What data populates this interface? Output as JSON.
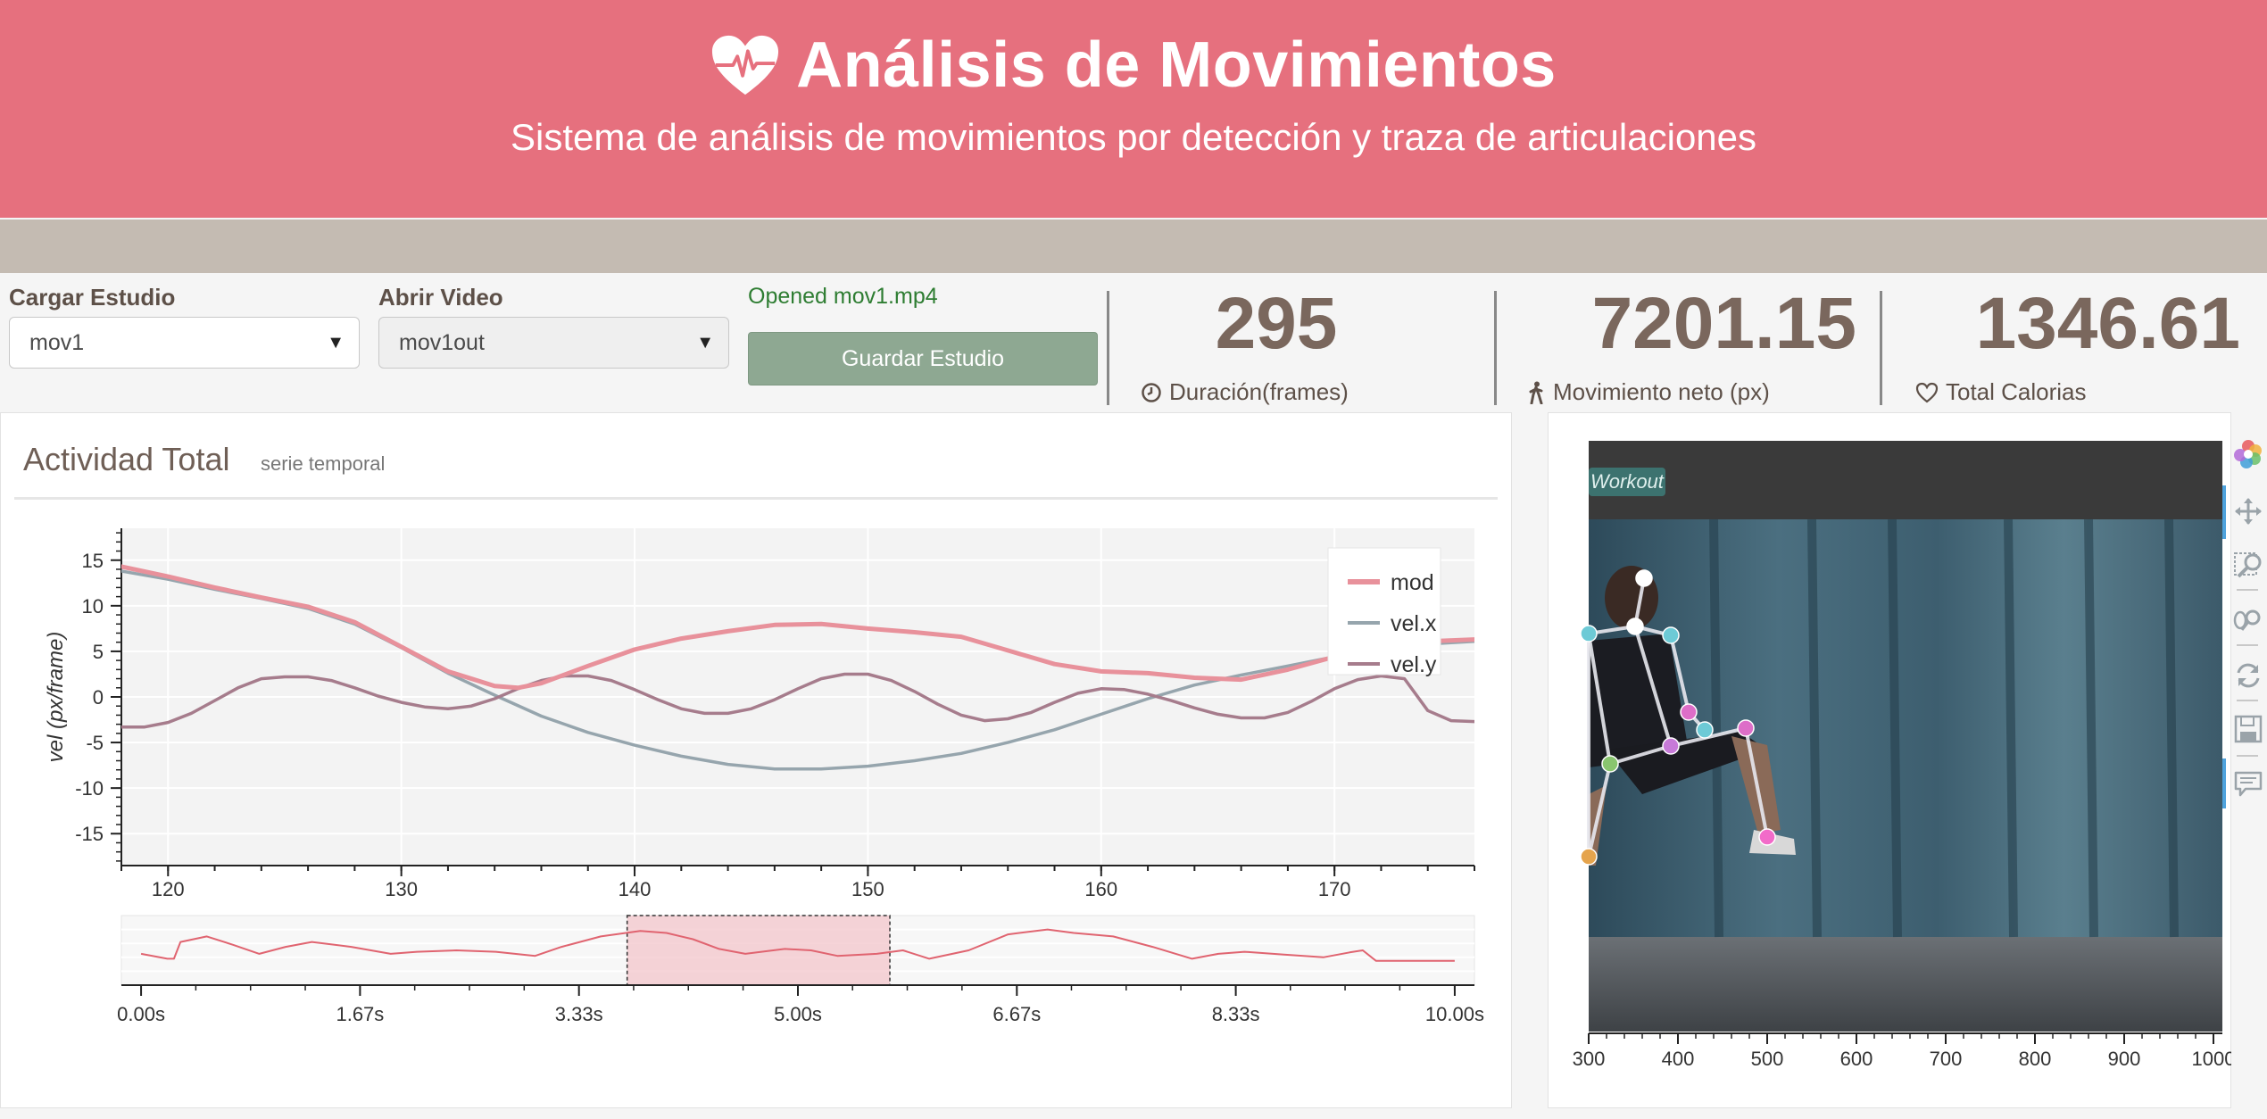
{
  "header": {
    "title": "Análisis de Movimientos",
    "subtitle": "Sistema de análisis de movimientos por detección y traza de articulaciones",
    "icon": "heartbeat-icon"
  },
  "controls": {
    "load_label": "Cargar Estudio",
    "load_value": "mov1",
    "open_label": "Abrir Video",
    "open_value": "mov1out",
    "status": "Opened mov1.mp4",
    "save_label": "Guardar Estudio"
  },
  "stats": [
    {
      "value": "295",
      "label": "Duración(frames)",
      "icon": "clock-icon"
    },
    {
      "value": "7201.15",
      "label": "Movimiento neto (px)",
      "icon": "walking-icon"
    },
    {
      "value": "1346.61",
      "label": "Total Calorias",
      "icon": "heart-icon"
    }
  ],
  "activity": {
    "title": "Actividad Total",
    "subtitle": "serie temporal"
  },
  "colors": {
    "header": "#e6707e",
    "mod": "#e8919b",
    "velx": "#96a5ad",
    "vely": "#a67c8c"
  },
  "chart_data": [
    {
      "type": "line",
      "ylabel": "vel (px/frame)",
      "xlim": [
        118,
        176
      ],
      "ylim": [
        -18.5,
        18.5
      ],
      "x_ticks": [
        120,
        130,
        140,
        150,
        160,
        170
      ],
      "y_ticks": [
        15,
        10,
        5,
        0,
        -5,
        -10,
        -15
      ],
      "grid": true,
      "legend": "top-right",
      "series": [
        {
          "name": "mod",
          "color": "#e8919b",
          "x": [
            118,
            120,
            122,
            124,
            126,
            128,
            130,
            132,
            134,
            135,
            136,
            138,
            140,
            142,
            144,
            146,
            148,
            150,
            152,
            154,
            156,
            158,
            160,
            162,
            164,
            166,
            168,
            170,
            172,
            174,
            176
          ],
          "y": [
            14.3,
            13.2,
            12,
            10.9,
            9.9,
            8.2,
            5.5,
            2.8,
            1.2,
            1.0,
            1.5,
            3.4,
            5.2,
            6.4,
            7.2,
            7.9,
            8.0,
            7.5,
            7.1,
            6.6,
            5.1,
            3.6,
            2.8,
            2.6,
            2.1,
            1.9,
            3.0,
            4.4,
            5.4,
            6.1,
            6.3
          ]
        },
        {
          "name": "vel.x",
          "color": "#96a5ad",
          "x": [
            118,
            120,
            122,
            124,
            126,
            128,
            130,
            132,
            134,
            136,
            138,
            140,
            142,
            144,
            146,
            148,
            150,
            152,
            154,
            156,
            158,
            160,
            162,
            164,
            166,
            168,
            170,
            172,
            174,
            176
          ],
          "y": [
            13.8,
            12.9,
            11.8,
            10.8,
            9.7,
            8.0,
            5.4,
            2.6,
            0.2,
            -2.1,
            -3.9,
            -5.3,
            -6.5,
            -7.4,
            -7.9,
            -7.9,
            -7.6,
            -7.0,
            -6.2,
            -5.0,
            -3.6,
            -1.9,
            -0.2,
            1.3,
            2.4,
            3.4,
            4.4,
            5.2,
            5.8,
            6.1
          ]
        },
        {
          "name": "vel.y",
          "color": "#a67c8c",
          "x": [
            118,
            119,
            120,
            121,
            122,
            123,
            124,
            125,
            126,
            127,
            128,
            129,
            130,
            131,
            132,
            133,
            134,
            135,
            136,
            137,
            138,
            139,
            140,
            141,
            142,
            143,
            144,
            145,
            146,
            147,
            148,
            149,
            150,
            151,
            152,
            153,
            154,
            155,
            156,
            157,
            158,
            159,
            160,
            161,
            162,
            163,
            164,
            165,
            166,
            167,
            168,
            169,
            170,
            171,
            172,
            173,
            174,
            175,
            176
          ],
          "y": [
            -3.3,
            -3.3,
            -2.8,
            -1.8,
            -0.4,
            1.0,
            2.0,
            2.2,
            2.2,
            1.8,
            1.0,
            0.1,
            -0.6,
            -1.1,
            -1.3,
            -1.0,
            -0.2,
            0.9,
            1.8,
            2.3,
            2.3,
            1.8,
            0.8,
            -0.3,
            -1.3,
            -1.8,
            -1.8,
            -1.3,
            -0.3,
            0.9,
            2.0,
            2.5,
            2.5,
            1.8,
            0.6,
            -0.8,
            -2.0,
            -2.6,
            -2.4,
            -1.7,
            -0.6,
            0.4,
            0.9,
            0.8,
            0.3,
            -0.4,
            -1.2,
            -1.9,
            -2.3,
            -2.3,
            -1.7,
            -0.5,
            0.9,
            1.9,
            2.3,
            2.0,
            -1.5,
            -2.6,
            -2.7
          ]
        }
      ]
    },
    {
      "type": "line",
      "role": "range selector",
      "x_ticks": [
        "0.00s",
        "1.67s",
        "3.33s",
        "5.00s",
        "6.67s",
        "8.33s",
        "10.00s"
      ],
      "xlim": [
        -0.15,
        10.15
      ],
      "selection": [
        3.7,
        5.7
      ],
      "series": [
        {
          "name": "mod",
          "color": "#e06470",
          "x": [
            0,
            0.2,
            0.25,
            0.3,
            0.5,
            0.7,
            0.9,
            1.1,
            1.3,
            1.6,
            1.9,
            2.1,
            2.4,
            2.7,
            3.0,
            3.2,
            3.5,
            3.8,
            4.0,
            4.2,
            4.4,
            4.6,
            4.9,
            5.1,
            5.3,
            5.6,
            5.8,
            6.0,
            6.3,
            6.6,
            6.9,
            7.1,
            7.4,
            7.7,
            8.0,
            8.2,
            8.4,
            8.7,
            9.0,
            9.2,
            9.3,
            9.4,
            9.5,
            9.7,
            9.9,
            10.0
          ],
          "y": [
            0.45,
            0.38,
            0.38,
            0.62,
            0.7,
            0.58,
            0.45,
            0.55,
            0.62,
            0.55,
            0.45,
            0.48,
            0.5,
            0.48,
            0.42,
            0.55,
            0.7,
            0.78,
            0.75,
            0.66,
            0.52,
            0.45,
            0.52,
            0.5,
            0.42,
            0.45,
            0.5,
            0.38,
            0.5,
            0.73,
            0.8,
            0.75,
            0.7,
            0.55,
            0.38,
            0.45,
            0.48,
            0.44,
            0.4,
            0.47,
            0.5,
            0.35,
            0.35,
            0.35,
            0.35,
            0.35
          ]
        }
      ]
    },
    {
      "type": "image",
      "x_ticks": [
        300,
        400,
        500,
        600,
        700,
        800,
        900,
        1000
      ],
      "overlay_text": "Workout",
      "joint_colors": [
        "#ffffff",
        "#6dcad6",
        "#e5a44d",
        "#dd6ec8",
        "#c77ad8",
        "#e57896",
        "#f26bc9",
        "#89c56f"
      ]
    }
  ]
}
